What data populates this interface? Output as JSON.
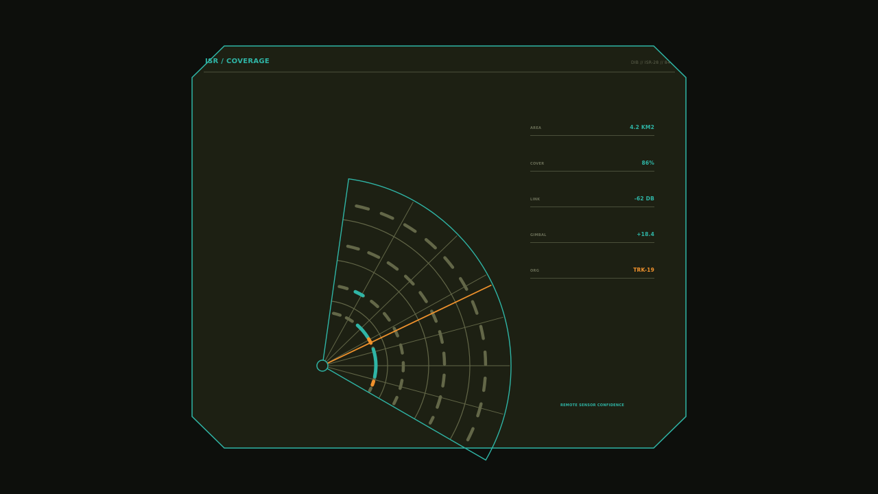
{
  "header": {
    "title": "ISR / COVERAGE",
    "ref": "DIB // ISR-28 // 84"
  },
  "stats": [
    {
      "label": "AREA",
      "value": "4.2 KM2",
      "tone": "teal"
    },
    {
      "label": "COVER",
      "value": "86%",
      "tone": "teal"
    },
    {
      "label": "LINK",
      "value": "-62 DB",
      "tone": "teal"
    },
    {
      "label": "GIMBAL",
      "value": "+18.4",
      "tone": "teal"
    },
    {
      "label": "ORG",
      "value": "TRK-19",
      "tone": "orange"
    }
  ],
  "caption": "REMOTE SENSOR CONFIDENCE",
  "colors": {
    "teal": "#2fb5a6",
    "orange": "#f0922d",
    "panel_bg": "#1d2013",
    "olive": "#636748",
    "label": "#6b6f58",
    "ref": "#60644f"
  }
}
